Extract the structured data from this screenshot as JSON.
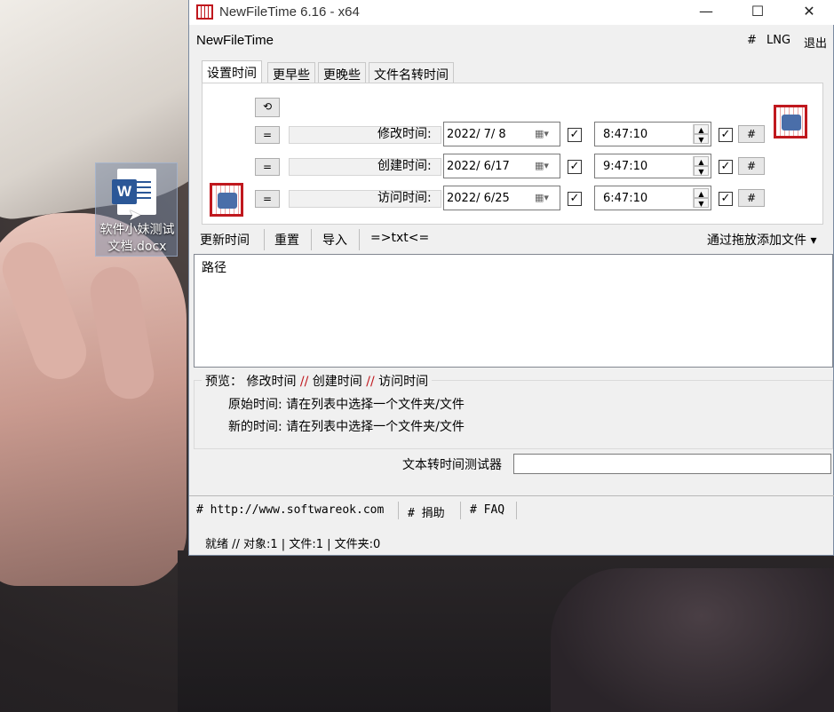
{
  "desktop": {
    "icon_label_line1": "软件小妹测试",
    "icon_label_line2": "文档.docx",
    "icon_badge": "W"
  },
  "window": {
    "title": "NewFileTime 6.16 - x64",
    "minimize": "—",
    "maximize": "☐",
    "close": "✕"
  },
  "menu": {
    "app_name": "NewFileTime",
    "hash": "#",
    "lng": "LNG",
    "exit": "退出"
  },
  "tabs": [
    "设置时间",
    "更早些",
    "更晚些",
    "文件名转时间"
  ],
  "rows": [
    {
      "equal": "=",
      "label": "修改时间:",
      "date": "2022/  7/  8",
      "time": "8:47:10",
      "hash": "#"
    },
    {
      "equal": "=",
      "label": "创建时间:",
      "date": "2022/  6/17",
      "time": "9:47:10",
      "hash": "#"
    },
    {
      "equal": "=",
      "label": "访问时间:",
      "date": "2022/  6/25",
      "time": "6:47:10",
      "hash": "#"
    }
  ],
  "toolbar": {
    "update": "更新时间",
    "reset": "重置",
    "import": "导入",
    "txt": "=>txt<=",
    "drag": "通过拖放添加文件 ▾"
  },
  "list": {
    "header": "路径"
  },
  "preview": {
    "label": "预览：",
    "mod": "修改时间",
    "sep1": "//",
    "create": "创建时间",
    "sep2": "//",
    "access": "访问时间",
    "orig": "原始时间: 请在列表中选择一个文件夹/文件",
    "new": "新的时间: 请在列表中选择一个文件夹/文件"
  },
  "tester": {
    "label": "文本转时间测试器",
    "value": ""
  },
  "links": {
    "url": "# http://www.softwareok.com",
    "donate": "# 捐助",
    "faq": "# FAQ"
  },
  "status": {
    "text": "就绪 // 对象:1  | 文件:1   | 文件夹:0"
  }
}
